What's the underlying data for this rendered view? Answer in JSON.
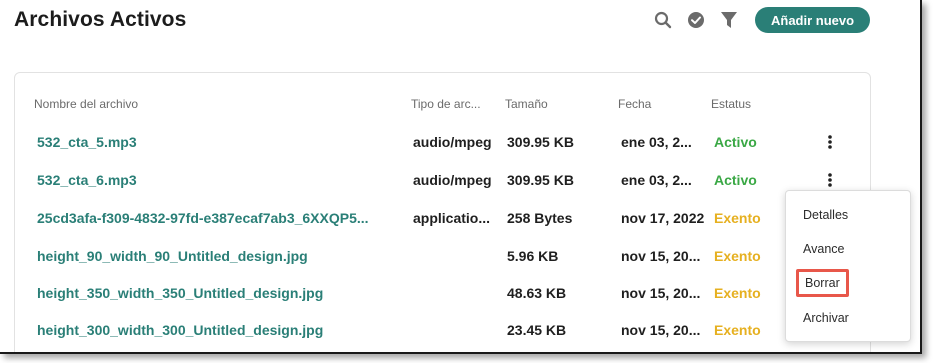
{
  "page": {
    "title": "Archivos Activos",
    "add_button_label": "Añadir nuevo"
  },
  "toolbar": {
    "icons": [
      "search-icon",
      "check-circle-icon",
      "filter-icon"
    ]
  },
  "colors": {
    "accent": "#2a7f77",
    "active": "#3aa845",
    "exempt": "#e6b020",
    "highlight_border": "#e8574a"
  },
  "table": {
    "headers": {
      "name": "Nombre del archivo",
      "type": "Tipo de arc...",
      "size": "Tamaño",
      "date": "Fecha",
      "status": "Estatus"
    },
    "rows": [
      {
        "name": "532_cta_5.mp3",
        "type": "audio/mpeg",
        "size": "309.95 KB",
        "date": "ene 03, 2...",
        "status": "Activo"
      },
      {
        "name": "532_cta_6.mp3",
        "type": "audio/mpeg",
        "size": "309.95 KB",
        "date": "ene 03, 2...",
        "status": "Activo"
      },
      {
        "name": "25cd3afa-f309-4832-97fd-e387ecaf7ab3_6XXQP5...",
        "type": "applicatio...",
        "size": "258 Bytes",
        "date": "nov 17, 2022",
        "status": "Exento"
      },
      {
        "name": "height_90_width_90_Untitled_design.jpg",
        "type": "",
        "size": "5.96 KB",
        "date": "nov 15, 20...",
        "status": "Exento"
      },
      {
        "name": "height_350_width_350_Untitled_design.jpg",
        "type": "",
        "size": "48.63 KB",
        "date": "nov 15, 20...",
        "status": "Exento"
      },
      {
        "name": "height_300_width_300_Untitled_design.jpg",
        "type": "",
        "size": "23.45 KB",
        "date": "nov 15, 20...",
        "status": "Exento"
      }
    ]
  },
  "context_menu": {
    "items": [
      "Detalles",
      "Avance",
      "Borrar",
      "Archivar"
    ],
    "highlighted": "Borrar"
  }
}
